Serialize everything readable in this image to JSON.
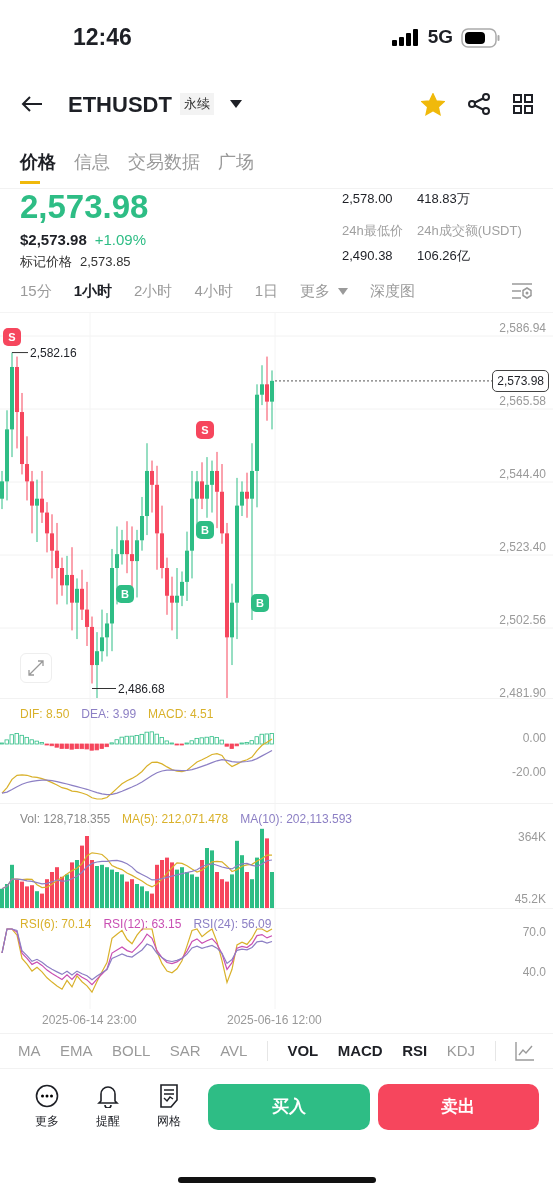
{
  "status_bar": {
    "time": "12:46",
    "network": "5G"
  },
  "header": {
    "symbol": "ETHUSDT",
    "tag": "永续",
    "favorite": true
  },
  "tabs": [
    {
      "label": "价格",
      "selected": true
    },
    {
      "label": "信息",
      "selected": false
    },
    {
      "label": "交易数据",
      "selected": false
    },
    {
      "label": "广场",
      "selected": false
    }
  ],
  "price": {
    "last": "2,573.98",
    "usd": "$2,573.98",
    "change": "+1.09%",
    "mark_label": "标记价格",
    "mark_value": "2,573.85"
  },
  "stats": [
    {
      "value": "2,578.00"
    },
    {
      "value": "418.83万"
    },
    {
      "label": "24h最低价",
      "value": "2,490.38"
    },
    {
      "label": "24h成交额(USDT)",
      "value": "106.26亿"
    }
  ],
  "intervals": [
    {
      "label": "15分",
      "selected": false
    },
    {
      "label": "1小时",
      "selected": true
    },
    {
      "label": "2小时",
      "selected": false
    },
    {
      "label": "4小时",
      "selected": false
    },
    {
      "label": "1日",
      "selected": false
    }
  ],
  "more": "更多",
  "depth": "深度图",
  "chart": {
    "price_axis": [
      "2,586.94",
      "2,565.58",
      "2,544.40",
      "2,523.40",
      "2,502.56",
      "2,481.90"
    ],
    "last_price": "2,573.98",
    "high_label": "2,582.16",
    "low_label": "2,486.68",
    "markers": [
      {
        "kind": "sell",
        "label": "S"
      },
      {
        "kind": "buy",
        "label": "B"
      },
      {
        "kind": "sell",
        "label": "S"
      },
      {
        "kind": "buy",
        "label": "B"
      },
      {
        "kind": "buy",
        "label": "B"
      }
    ]
  },
  "macd": {
    "legend": [
      {
        "text": "DIF: 8.50",
        "color": "#d9b12b"
      },
      {
        "text": "DEA: 3.99",
        "color": "#8c7fc4"
      },
      {
        "text": "MACD: 4.51",
        "color": "#d9b12b"
      }
    ],
    "axis": [
      "0.00",
      "-20.00"
    ]
  },
  "volume": {
    "legend": [
      {
        "text": "Vol: 128,718.355",
        "color": "#8a8a8a"
      },
      {
        "text": "MA(5): 212,071.478",
        "color": "#d9b12b"
      },
      {
        "text": "MA(10): 202,113.593",
        "color": "#8c7fc4"
      }
    ],
    "axis": [
      "364K",
      "45.2K"
    ]
  },
  "rsi": {
    "legend": [
      {
        "text": "RSI(6): 70.14",
        "color": "#d9b12b"
      },
      {
        "text": "RSI(12): 63.15",
        "color": "#c94fb3"
      },
      {
        "text": "RSI(24): 56.09",
        "color": "#8c7fc4"
      }
    ],
    "axis": [
      "70.0",
      "40.0"
    ]
  },
  "time_axis": [
    "2025-06-14 23:00",
    "2025-06-16 12:00"
  ],
  "indicators": [
    {
      "label": "MA",
      "kind": "main",
      "selected": false
    },
    {
      "label": "EMA",
      "kind": "main",
      "selected": false
    },
    {
      "label": "BOLL",
      "kind": "main",
      "selected": false
    },
    {
      "label": "SAR",
      "kind": "main",
      "selected": false
    },
    {
      "label": "AVL",
      "kind": "main",
      "selected": false
    },
    {
      "label": "VOL",
      "kind": "sub",
      "selected": true
    },
    {
      "label": "MACD",
      "kind": "sub",
      "selected": true
    },
    {
      "label": "RSI",
      "kind": "sub",
      "selected": true
    },
    {
      "label": "KDJ",
      "kind": "sub",
      "selected": false
    }
  ],
  "actions": [
    {
      "label": "更多",
      "kind": "more"
    },
    {
      "label": "提醒",
      "kind": "alert"
    },
    {
      "label": "网格",
      "kind": "grid"
    }
  ],
  "buy": "买入",
  "sell": "卖出"
}
